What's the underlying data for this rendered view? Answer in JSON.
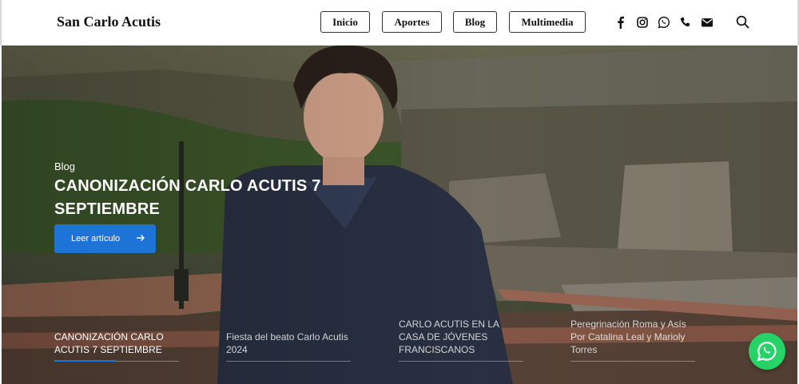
{
  "header": {
    "brand": "San Carlo Acutis",
    "nav": [
      {
        "label": "Inicio"
      },
      {
        "label": "Aportes"
      },
      {
        "label": "Blog"
      },
      {
        "label": "Multimedia"
      }
    ],
    "social_icons": [
      "facebook-icon",
      "instagram-icon",
      "whatsapp-icon",
      "phone-icon",
      "email-icon"
    ],
    "search_icon": "search-icon"
  },
  "hero": {
    "kicker": "Blog",
    "title": "CANONIZACIÓN CARLO ACUTIS 7 SEPTIEMBRE",
    "cta_label": "Leer artículo",
    "accent_color": "#1e73d6"
  },
  "slider_tabs": [
    {
      "label": "CANONIZACIÓN CARLO ACUTIS 7 SEPTIEMBRE",
      "active": true
    },
    {
      "label": "Fiesta del beato Carlo Acutis 2024",
      "active": false
    },
    {
      "label": "CARLO ACUTIS EN LA CASA DE JÓVENES FRANCISCANOS",
      "active": false
    },
    {
      "label": "Peregrinación Roma y Asís Por Catalina Leal y Marioly Torres",
      "active": false
    }
  ],
  "floating": {
    "icon": "whatsapp-icon",
    "color": "#25d366"
  }
}
